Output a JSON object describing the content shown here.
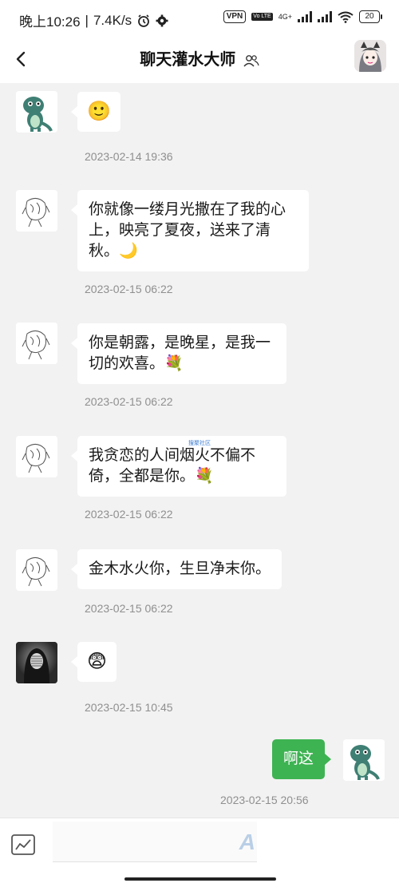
{
  "status_bar": {
    "time": "晚上10:26",
    "net_speed": "7.4K/s",
    "vpn": "VPN",
    "volte": "Vo LTE",
    "network_type": "4G+",
    "battery": "20"
  },
  "header": {
    "title": "聊天灌水大师"
  },
  "messages": [
    {
      "side": "left",
      "avatar": "dinosaur-avatar",
      "text": "🙂",
      "time": "2023-02-14 19:36"
    },
    {
      "side": "left",
      "avatar": "sketch-avatar",
      "text": "你就像一缕月光撒在了我的心上，映亮了夏夜，送来了清秋。🌙",
      "time": "2023-02-15 06:22"
    },
    {
      "side": "left",
      "avatar": "sketch-avatar",
      "text": "你是朝露，是晚星，是我一切的欢喜。💐",
      "time": "2023-02-15 06:22"
    },
    {
      "side": "left",
      "avatar": "sketch-avatar",
      "text": "我贪恋的人间烟火不偏不倚，全都是你。💐",
      "time": "2023-02-15 06:22"
    },
    {
      "side": "left",
      "avatar": "sketch-avatar",
      "text": "金木水火你，生旦净末你。",
      "time": "2023-02-15 06:22"
    },
    {
      "side": "left",
      "avatar": "hooded-figure-avatar",
      "text": "😨",
      "time": "2023-02-15 10:45"
    },
    {
      "side": "right",
      "avatar": "dinosaur-avatar",
      "text": "啊这",
      "time": "2023-02-15 20:56"
    }
  ],
  "watermark": "搜聚社区",
  "bottom_bar": {
    "input_glyph": "A"
  },
  "colors": {
    "accent_green": "#3db352",
    "background": "#f2f2f2",
    "timestamp": "#8f8f8f"
  },
  "icons": [
    "back-arrow-icon",
    "group-icon",
    "chart-icon",
    "clock-icon",
    "gear-icon",
    "signal-icon",
    "wifi-icon"
  ]
}
